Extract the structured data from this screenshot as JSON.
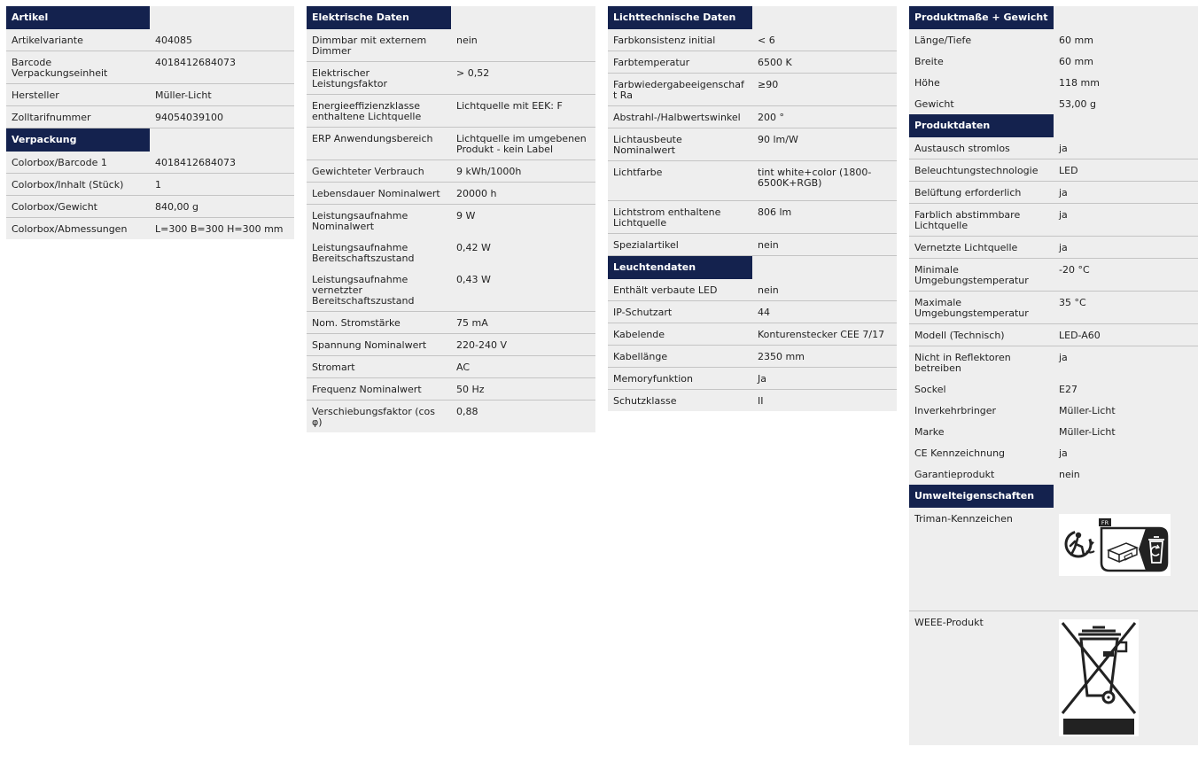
{
  "columns": [
    {
      "sections": [
        {
          "title": "Artikel",
          "rows": [
            [
              "Artikelvariante",
              "404085"
            ],
            [
              "Barcode Verpackungseinheit",
              "4018412684073"
            ],
            [
              "Hersteller",
              "Müller-Licht"
            ],
            [
              "Zolltarifnummer",
              "94054039100"
            ]
          ]
        },
        {
          "title": "Verpackung",
          "rows": [
            [
              "Colorbox/Barcode 1",
              "4018412684073"
            ],
            [
              "Colorbox/Inhalt (Stück)",
              "1"
            ],
            [
              "Colorbox/Gewicht",
              "840,00 g"
            ],
            [
              "Colorbox/Abmessungen",
              "L=300 B=300 H=300 mm"
            ]
          ]
        }
      ]
    },
    {
      "sections": [
        {
          "title": "Elektrische Daten",
          "rows": [
            [
              "Dimmbar mit externem Dimmer",
              "nein"
            ],
            [
              "Elektrischer Leistungsfaktor",
              "> 0,52"
            ],
            [
              "Energieeffizienzklasse enthaltene Lichtquelle",
              "Lichtquelle mit EEK: F"
            ],
            [
              "ERP Anwendungsbereich",
              "Lichtquelle im umgebenen Produkt - kein Label"
            ],
            [
              "Gewichteter Verbrauch",
              "9 kWh/1000h"
            ],
            [
              "Lebensdauer Nominalwert",
              "20000 h"
            ],
            [
              "Leistungsaufnahme Nominalwert",
              "9 W"
            ],
            [
              "Leistungsaufnahme Bereitschaftszustand",
              "0,42 W"
            ],
            [
              "Leistungsaufnahme vernetzter Bereitschaftszustand",
              "0,43 W"
            ],
            [
              "Nom. Stromstärke",
              "75 mA"
            ],
            [
              "Spannung Nominalwert",
              "220-240 V"
            ],
            [
              "Stromart",
              "AC"
            ],
            [
              "Frequenz Nominalwert",
              "50 Hz"
            ],
            [
              "Verschiebungsfaktor (cos φ)",
              "0,88"
            ]
          ]
        }
      ]
    },
    {
      "sections": [
        {
          "title": "Lichttechnische Daten",
          "rows": [
            [
              "Farbkonsistenz initial",
              "< 6"
            ],
            [
              "Farbtemperatur",
              "6500 K"
            ],
            [
              "Farbwiedergabeeigenschaft Ra",
              "≥90"
            ],
            [
              "Abstrahl-/Halbwertswinkel",
              "200 °"
            ],
            [
              "Lichtausbeute Nominalwert",
              "90 lm/W"
            ],
            [
              "Lichtfarbe",
              "tint white+color (1800-6500K+RGB)"
            ],
            [
              "Lichtstrom enthaltene Lichtquelle",
              "806 lm"
            ],
            [
              "Spezialartikel",
              "nein"
            ]
          ]
        },
        {
          "title": "Leuchtendaten",
          "rows": [
            [
              "Enthält verbaute LED",
              "nein"
            ],
            [
              "IP-Schutzart",
              "44"
            ],
            [
              "Kabelende",
              "Konturenstecker CEE 7/17"
            ],
            [
              "Kabellänge",
              "2350 mm"
            ],
            [
              "Memoryfunktion",
              "Ja"
            ],
            [
              "Schutzklasse",
              "II"
            ]
          ]
        }
      ]
    },
    {
      "sections": [
        {
          "title": "Produktmaße + Gewicht",
          "rows": [
            [
              "Länge/Tiefe",
              "60 mm"
            ],
            [
              "Breite",
              "60 mm"
            ],
            [
              "Höhe",
              "118 mm"
            ],
            [
              "Gewicht",
              "53,00 g"
            ]
          ]
        },
        {
          "title": "Produktdaten",
          "rows": [
            [
              "Austausch stromlos",
              "ja"
            ],
            [
              "Beleuchtungstechnologie",
              "LED"
            ],
            [
              "Belüftung erforderlich",
              "ja"
            ],
            [
              "Farblich abstimmbare Lichtquelle",
              "ja"
            ],
            [
              "Vernetzte Lichtquelle",
              "ja"
            ],
            [
              "Minimale Umgebungstemperatur",
              "-20 °C"
            ],
            [
              "Maximale Umgebungstemperatur",
              "35 °C"
            ],
            [
              "Modell (Technisch)",
              "LED-A60"
            ],
            [
              "Nicht in Reflektoren betreiben",
              "ja"
            ],
            [
              "Sockel",
              "E27"
            ],
            [
              "Inverkehrbringer",
              "Müller-Licht"
            ],
            [
              "Marke",
              "Müller-Licht"
            ],
            [
              "CE Kennzeichnung",
              "ja"
            ],
            [
              "Garantieprodukt",
              "nein"
            ]
          ]
        },
        {
          "title": "Umwelteigenschaften",
          "rows": [
            [
              "Triman-Kennzeichen",
              ""
            ],
            [
              "WEEE-Produkt",
              ""
            ]
          ]
        }
      ]
    }
  ],
  "icons": {
    "triman": "triman-logo",
    "triman_badge": "FR",
    "weee": "weee-crossed-bin-symbol"
  },
  "colors": {
    "header_bg": "#14224e",
    "header_text": "#ffffff",
    "row_bg": "#eeeeee",
    "row_border": "#c4c4c4"
  }
}
